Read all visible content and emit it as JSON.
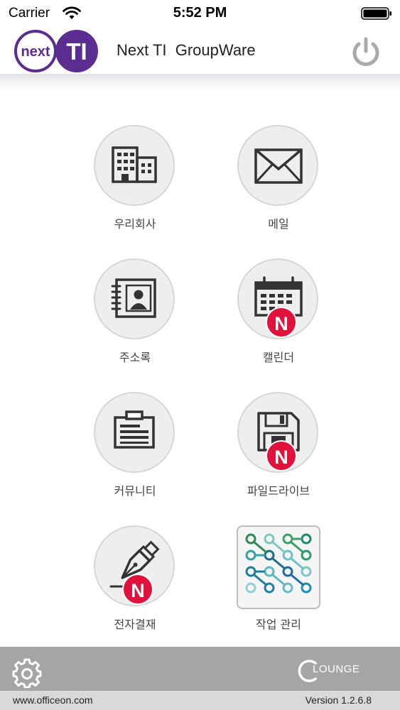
{
  "status_bar": {
    "carrier": "Carrier",
    "time": "5:52 PM",
    "icons": [
      "wifi-icon",
      "battery-icon"
    ]
  },
  "header": {
    "logo_text_left": "next",
    "logo_text_right": "TI",
    "title": "Next TI  GroupWare",
    "power_icon": "power-icon"
  },
  "colors": {
    "logo_purple": "#5c2d91",
    "badge_red": "#e0123c",
    "bottom_bar": "#a5a5a5",
    "footer": "#d9d9d9"
  },
  "menu": {
    "items": [
      {
        "label": "우리회사",
        "icon": "building-icon",
        "badge": ""
      },
      {
        "label": "메일",
        "icon": "mail-icon",
        "badge": ""
      },
      {
        "label": "주소록",
        "icon": "address-book-icon",
        "badge": ""
      },
      {
        "label": "캘린더",
        "icon": "calendar-icon",
        "badge": "N"
      },
      {
        "label": "커뮤니티",
        "icon": "clipboard-icon",
        "badge": ""
      },
      {
        "label": "파일드라이브",
        "icon": "floppy-disk-icon",
        "badge": "N"
      },
      {
        "label": "전자결재",
        "icon": "fountain-pen-icon",
        "badge": "N"
      },
      {
        "label": "작업 관리",
        "icon": "task-network-icon",
        "badge": ""
      }
    ]
  },
  "bottom_bar": {
    "settings_icon": "gear-icon",
    "lounge_label": "LOUNGE"
  },
  "footer": {
    "url": "www.officeon.com",
    "version": "Version 1.2.6.8"
  }
}
